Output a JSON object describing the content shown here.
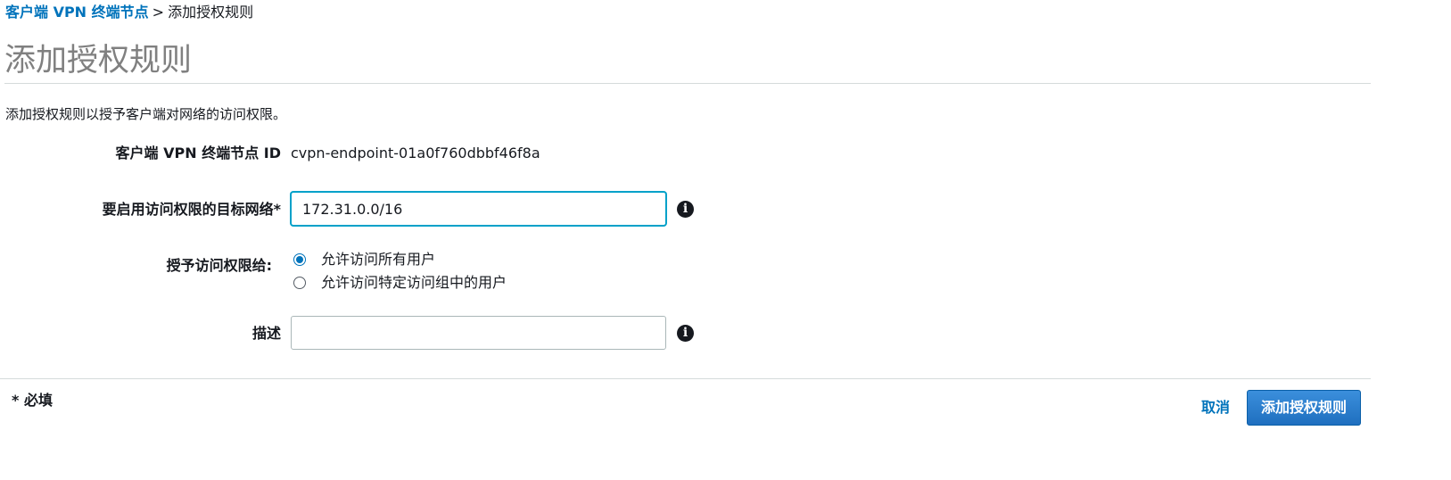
{
  "breadcrumb": {
    "parent_label": "客户端 VPN 终端节点",
    "separator": ">",
    "current_label": "添加授权规则"
  },
  "page": {
    "title": "添加授权规则",
    "intro": "添加授权规则以授予客户端对网络的访问权限。"
  },
  "form": {
    "endpoint": {
      "label": "客户端 VPN 终端节点 ID",
      "value": "cvpn-endpoint-01a0f760dbbf46f8a"
    },
    "destination": {
      "label": "要启用访问权限的目标网络*",
      "value": "172.31.0.0/16",
      "focused": true
    },
    "grant_access": {
      "label": "授予访问权限给:",
      "options": [
        {
          "label": "允许访问所有用户",
          "selected": true
        },
        {
          "label": "允许访问特定访问组中的用户",
          "selected": false
        }
      ]
    },
    "description": {
      "label": "描述",
      "value": ""
    },
    "info_icon_glyph": "i"
  },
  "footer": {
    "required_note": "* 必填",
    "cancel_label": "取消",
    "submit_label": "添加授权规则"
  },
  "colors": {
    "link": "#0073bb",
    "primary_button": "#1f6fbf",
    "focus_border": "#00a1c9",
    "title_gray": "#808080"
  }
}
